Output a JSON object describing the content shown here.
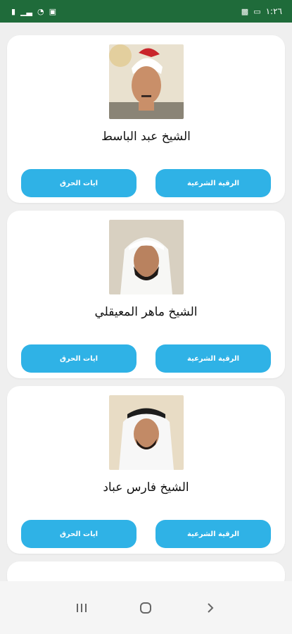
{
  "status_bar": {
    "time": "١:٢٦",
    "left_icons": [
      "battery-saver-icon",
      "signal-icon",
      "wifi-icon",
      "screen-record-icon"
    ],
    "right_icons": [
      "sim-icon",
      "message-icon"
    ]
  },
  "cards": [
    {
      "name": "الشيخ عبد الباسط",
      "ruqyah_label": "الرقية الشرعية",
      "burning_label": "ايات الحرق"
    },
    {
      "name": "الشيخ ماهر المعيقلي",
      "ruqyah_label": "الرقية الشرعية",
      "burning_label": "ايات الحرق"
    },
    {
      "name": "الشيخ فارس عباد",
      "ruqyah_label": "الرقية الشرعية",
      "burning_label": "ايات الحرق"
    }
  ],
  "navigation": {
    "recent_icon": "recent-apps-icon",
    "home_icon": "home-icon",
    "back_icon": "back-icon"
  },
  "colors": {
    "status_bar": "#1f6b3a",
    "button": "#2fb2e6",
    "card": "#ffffff",
    "background": "#efefef"
  }
}
